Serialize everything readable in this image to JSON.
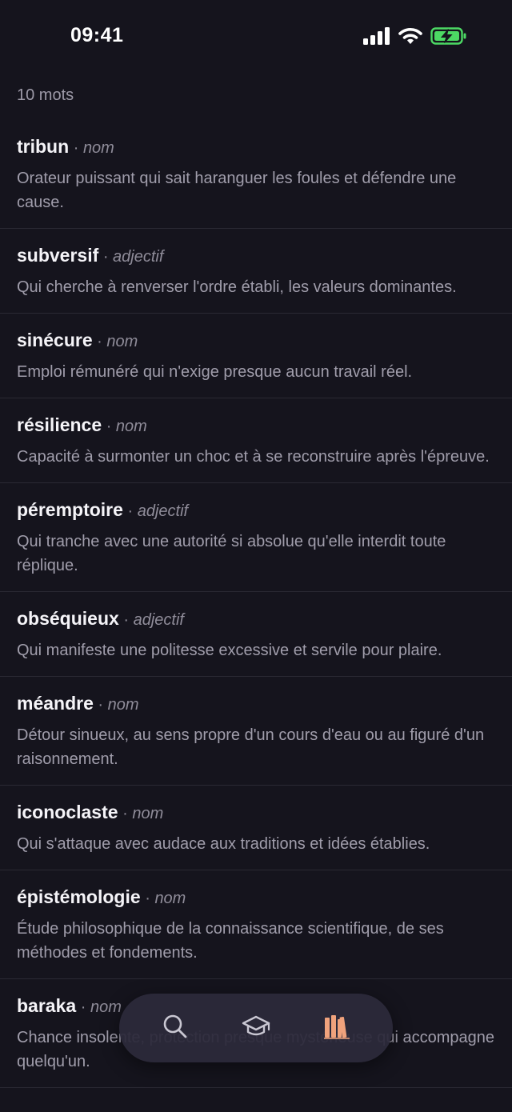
{
  "status_bar": {
    "time": "09:41",
    "icons": [
      "cellular-signal-icon",
      "wifi-icon",
      "battery-charging-icon"
    ],
    "battery_color": "#4cd964"
  },
  "header": {
    "count_label": "10 mots"
  },
  "words": [
    {
      "term": "tribun",
      "sep": " · ",
      "pos": "nom",
      "definition": "Orateur puissant qui sait haranguer les foules et défendre une cause."
    },
    {
      "term": "subversif",
      "sep": " · ",
      "pos": "adjectif",
      "definition": "Qui cherche à renverser l'ordre établi, les valeurs dominantes."
    },
    {
      "term": "sinécure",
      "sep": " · ",
      "pos": "nom",
      "definition": "Emploi rémunéré qui n'exige presque aucun travail réel."
    },
    {
      "term": "résilience",
      "sep": " · ",
      "pos": "nom",
      "definition": "Capacité à surmonter un choc et à se reconstruire après l'épreuve."
    },
    {
      "term": "péremptoire",
      "sep": " · ",
      "pos": "adjectif",
      "definition": "Qui tranche avec une autorité si absolue qu'elle interdit toute réplique."
    },
    {
      "term": "obséquieux",
      "sep": " · ",
      "pos": "adjectif",
      "definition": "Qui manifeste une politesse excessive et servile pour plaire."
    },
    {
      "term": "méandre",
      "sep": " · ",
      "pos": "nom",
      "definition": "Détour sinueux, au sens propre d'un cours d'eau ou au figuré d'un raisonnement."
    },
    {
      "term": "iconoclaste",
      "sep": " · ",
      "pos": "nom",
      "definition": "Qui s'attaque avec audace aux traditions et idées établies."
    },
    {
      "term": "épistémologie",
      "sep": " · ",
      "pos": "nom",
      "definition": "Étude philosophique de la connaissance scientifique, de ses méthodes et fondements."
    },
    {
      "term": "baraka",
      "sep": " · ",
      "pos": "nom",
      "definition": "Chance insolente, protection presque mystérieuse qui accompagne quelqu'un."
    }
  ],
  "tab_bar": {
    "tabs": [
      {
        "icon": "search-icon",
        "active": false
      },
      {
        "icon": "graduation-cap-icon",
        "active": false
      },
      {
        "icon": "library-books-icon",
        "active": true
      }
    ],
    "active_color": "#f0a27c",
    "inactive_color": "#c9c7d2"
  }
}
